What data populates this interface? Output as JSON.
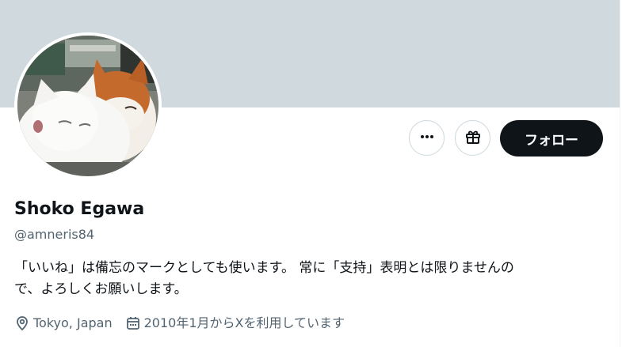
{
  "profile": {
    "display_name": "Shoko Egawa",
    "handle": "@amneris84",
    "bio_line1": "「いいね」は備忘のマークとしても使います。 常に「支持」表明とは限りませんの",
    "bio_line2": "で、よろしくお願いします。",
    "location": "Tokyo, Japan",
    "joined": "2010年1月からXを利用しています"
  },
  "actions": {
    "more_icon": "more-horizontal-icon",
    "gift_icon": "gift-icon",
    "follow_label": "フォロー"
  },
  "icons": {
    "location": "location-pin-icon",
    "joined": "calendar-icon"
  },
  "colors": {
    "banner": "#cfd9de",
    "primary_text": "#0f1419",
    "secondary_text": "#536471",
    "follow_button": "#0f1419",
    "border": "#cfd9de"
  }
}
